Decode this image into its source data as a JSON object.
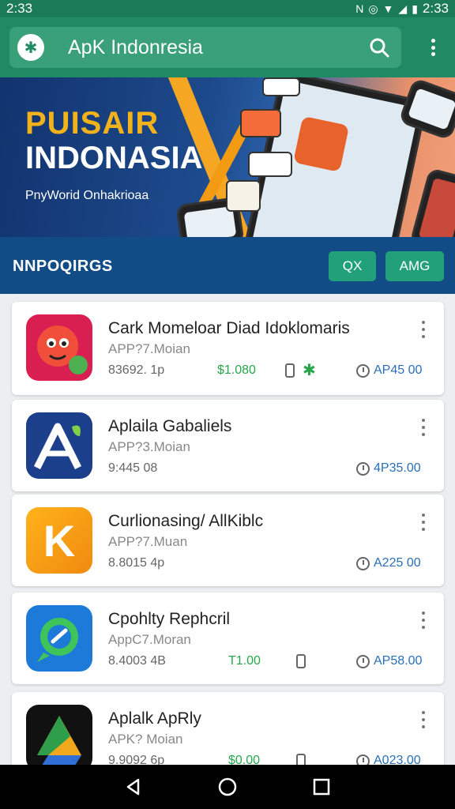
{
  "status_bar": {
    "time_left": "2:33",
    "time_right": "2:33"
  },
  "app_bar": {
    "title": "ApK Indonresia"
  },
  "banner": {
    "title_line1": "PUISAIR",
    "title_line2": "INDONASIA",
    "subtitle": "PnyWorid Onhakrioaa"
  },
  "category_bar": {
    "title": "NNPOQIRGS",
    "button1_label": "QX",
    "button2_label": "AMG"
  },
  "apps": [
    {
      "name": "Cark Momeloar Diad Idoklomaris",
      "package": "APP?7.Moian",
      "size": "83692. 1p",
      "price": "$1.080",
      "rating": "AP45 00",
      "icon": "red-monster-icon"
    },
    {
      "name": "Aplaila Gabaliels",
      "package": "APP?3.Moian",
      "size": "9:445 08",
      "price": "",
      "rating": "4P35.00",
      "icon": "blue-a-icon"
    },
    {
      "name": "Curlionasing/ AllKiblc",
      "package": "APP?7.Muan",
      "size": "8.8015 4p",
      "price": "",
      "rating": "A225 00",
      "icon": "orange-k-icon"
    },
    {
      "name": "Cpohlty Rephcril",
      "package": "AppC7.Moran",
      "size": "8.4003 4B",
      "price": "T1.00",
      "rating": "AP58.00",
      "icon": "chat-bubble-icon"
    },
    {
      "name": "Aplalk ApRly",
      "package": "APK? Moian",
      "size": "9.9092 6p",
      "price": "$0.00",
      "rating": "A023.00",
      "icon": "triangle-icon"
    }
  ],
  "colors": {
    "app_bar": "#1f8a63",
    "category_bar": "#124c86",
    "accent_green": "#26a64a",
    "rating_blue": "#2a6fb8"
  }
}
